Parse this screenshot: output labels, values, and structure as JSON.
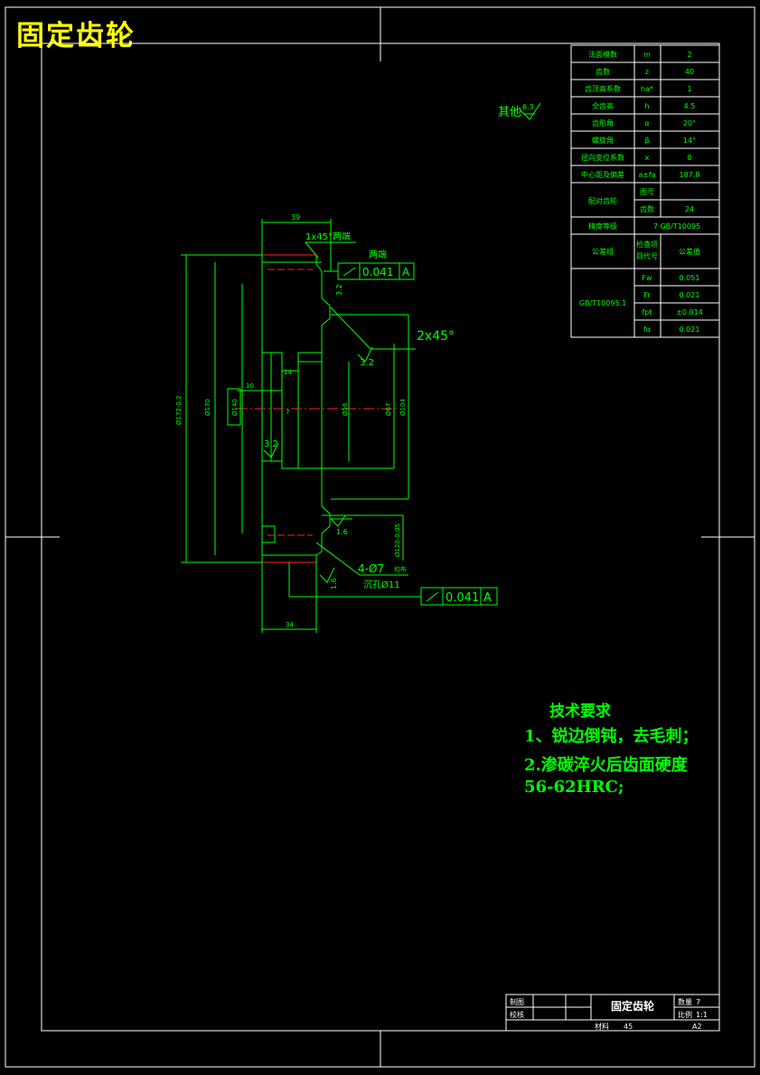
{
  "title": "固定齿轮",
  "param_table": {
    "rows": [
      {
        "name": "法面模数",
        "sym": "m",
        "val": "2"
      },
      {
        "name": "齿数",
        "sym": "z",
        "val": "40"
      },
      {
        "name": "齿顶高系数",
        "sym": "ha*",
        "val": "1"
      },
      {
        "name": "全齿高",
        "sym": "h",
        "val": "4.5"
      },
      {
        "name": "齿形角",
        "sym": "α",
        "val": "20°"
      },
      {
        "name": "螺旋角",
        "sym": "β",
        "val": "14°"
      },
      {
        "name": "径向变位系数",
        "sym": "x",
        "val": "0"
      },
      {
        "name": "中心距及偏差",
        "sym": "a±fa",
        "val": "187.8"
      },
      {
        "name": "配对齿轮",
        "sub1": "图号",
        "sub2": "齿数",
        "val2": "24"
      },
      {
        "name": "精度等级",
        "val": "7 GB/T10095"
      },
      {
        "name": "公差组",
        "sub1": "检查项",
        "sub1b": "目代号",
        "sub2": "公差值"
      },
      {
        "std": "GB/T10095.1",
        "items": [
          {
            "sym": "Fw",
            "val": "0.051"
          },
          {
            "sym": "Fr",
            "val": "0.021"
          },
          {
            "sym": "fpt",
            "val": "±0.014"
          },
          {
            "sym": "fα",
            "val": "0.021"
          }
        ]
      }
    ]
  },
  "annotations": {
    "other_roughness": "其他",
    "other_roughness_val": "6.3",
    "chamfer1": "1x45°",
    "both_ends1": "两端",
    "both_ends2": "两端",
    "chamfer2": "2x45°",
    "tol1": "0.041",
    "tol_ref1": "A",
    "tol2": "0.041",
    "tol_ref2": "A",
    "rough_32a": "3.2",
    "rough_32b": "3.2",
    "rough_32c": "3.2",
    "rough_16a": "1.6",
    "rough_16b": "1.6",
    "holes": "4-Ø7",
    "holes_suffix": "均布",
    "counterbore": "沉孔Ø11",
    "dim_top": "39",
    "dim_bottom": "34",
    "dim_14": "14",
    "dim_10": "10",
    "dim_7": "7",
    "dim_d172": "Ø172-0.2",
    "dim_d170": "Ø170",
    "dim_d140": "Ø140",
    "dim_d56": "Ø56",
    "dim_d67": "Ø67",
    "dim_d104": "Ø104",
    "dim_d120": "Ø120-0.05"
  },
  "tech_req": {
    "heading": "技术要求",
    "line1": "1、锐边倒钝，去毛刺；",
    "line2": "2.渗碳淬火后齿面硬度",
    "line3": "56-62HRC;"
  },
  "title_block": {
    "drawn": "制图",
    "checked": "校核",
    "name": "固定齿轮",
    "qty_label": "数量",
    "qty": "7",
    "scale_label": "比例",
    "scale": "1:1",
    "material_label": "材料",
    "material": "45",
    "size": "A2"
  },
  "colors": {
    "line": "#00ff00",
    "frame": "#ffffff",
    "center": "#ff2020",
    "title": "#ffff00"
  }
}
